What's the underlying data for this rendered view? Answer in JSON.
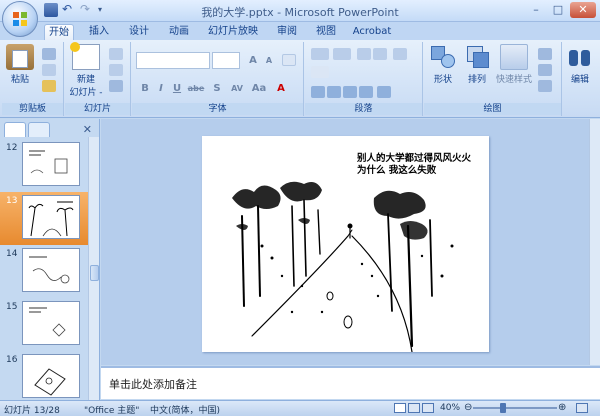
{
  "window": {
    "title": "我的大学.pptx - Microsoft PowerPoint",
    "minimize": "–",
    "maximize": "□",
    "close": "✕"
  },
  "tabs": [
    "开始",
    "插入",
    "设计",
    "动画",
    "幻灯片放映",
    "审阅",
    "视图",
    "Acrobat"
  ],
  "active_tab": "开始",
  "ribbon": {
    "clipboard": {
      "paste": "粘贴",
      "label": "剪贴板"
    },
    "slides": {
      "new_slide": "新建",
      "new_slide2": "幻灯片 -",
      "label": "幻灯片"
    },
    "font": {
      "label": "字体",
      "bold": "B",
      "italic": "I",
      "underline": "U",
      "strike": "abe",
      "shadow": "S",
      "spacing": "AV",
      "case": "Aa",
      "grow": "A",
      "shrink": "A"
    },
    "paragraph": {
      "label": "段落"
    },
    "drawing": {
      "shapes": "形状",
      "arrange": "排列",
      "quick_styles": "快速样式",
      "label": "绘图"
    },
    "editing": {
      "label": "编辑"
    }
  },
  "panel": {
    "close": "✕",
    "thumbnails": [
      {
        "number": "12",
        "selected": false
      },
      {
        "number": "13",
        "selected": true
      },
      {
        "number": "14",
        "selected": false
      },
      {
        "number": "15",
        "selected": false
      },
      {
        "number": "16",
        "selected": false
      }
    ]
  },
  "slide": {
    "line1": "别人的大学都过得风风火火",
    "line2": "为什么  我这么失败"
  },
  "notes": {
    "placeholder": "单击此处添加备注"
  },
  "status": {
    "slide_count": "幻灯片 13/28",
    "theme": "\"Office 主题\"",
    "language": "中文(简体，中国)",
    "zoom": "40%"
  },
  "colors": {
    "accent": "#1e395b",
    "selected_thumb": "#e78a2f",
    "ribbon_bg": "#d3e3f7"
  }
}
